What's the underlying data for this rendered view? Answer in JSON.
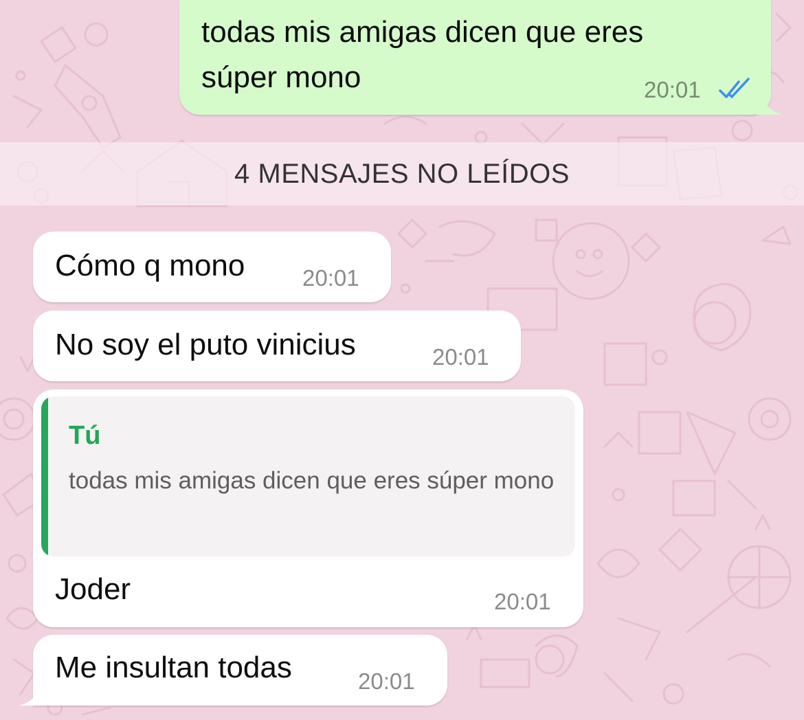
{
  "messages": {
    "m1": {
      "text_line1": "todas mis amigas dicen que eres",
      "text_line2": "súper mono",
      "time": "20:01",
      "status": "read"
    },
    "unread_divider": "4 MENSAJES NO LEÍDOS",
    "m2": {
      "text": "Cómo q mono",
      "time": "20:01"
    },
    "m3": {
      "text": "No soy el puto vinicius",
      "time": "20:01"
    },
    "m4": {
      "quote_author": "Tú",
      "quote_text": "todas mis amigas dicen que eres súper mono",
      "text": "Joder",
      "time": "20:01"
    },
    "m5": {
      "text": "Me insultan todas",
      "time": "20:01"
    }
  },
  "colors": {
    "wallpaper": "#f0d3df",
    "outgoing_bubble": "#d6fbcb",
    "incoming_bubble": "#ffffff",
    "read_ticks": "#3b8ff0",
    "quote_accent": "#26a85a"
  },
  "icons": {
    "read_receipt": "double-check-icon"
  }
}
